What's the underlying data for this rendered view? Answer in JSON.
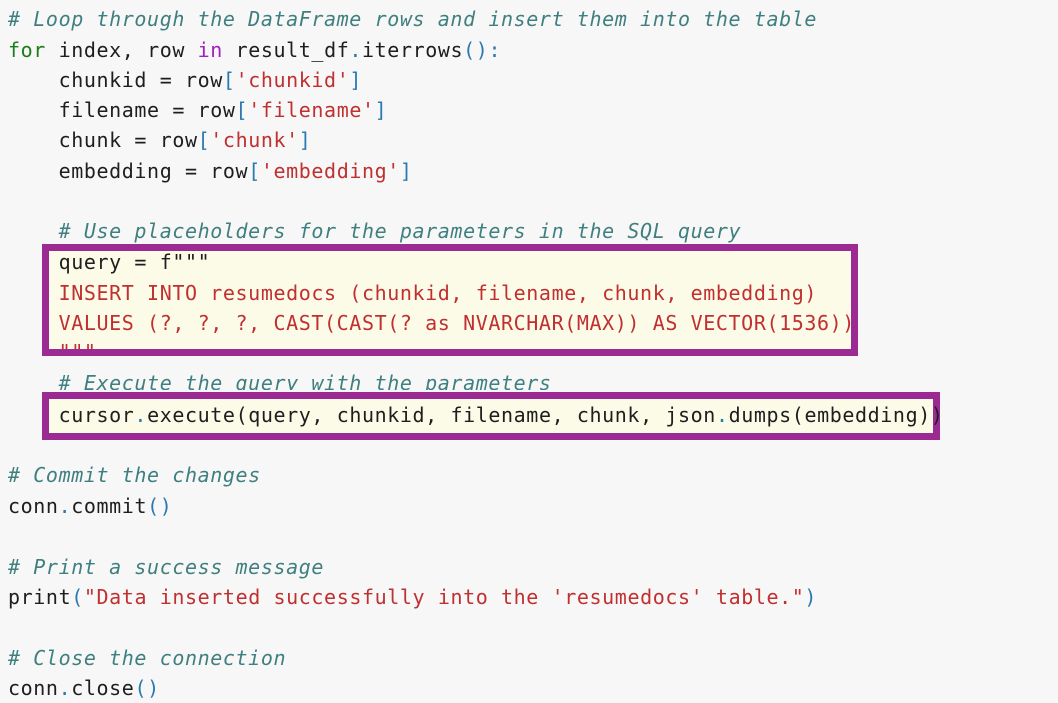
{
  "code": {
    "comment_loop": "# Loop through the DataFrame rows and insert them into the table",
    "for_kw": "for",
    "for_vars": " index, row ",
    "in_kw": "in",
    "for_iter": " result_df",
    "dot": ".",
    "iterrows": "iterrows",
    "parens_colon": "():",
    "chunkid_lhs": "    chunkid = row",
    "chunkid_str": "'chunkid'",
    "filename_lhs": "    filename = row",
    "filename_str": "'filename'",
    "chunk_lhs": "    chunk = row",
    "chunk_str": "'chunk'",
    "embedding_lhs": "    embedding = row",
    "embedding_str": "'embedding'",
    "lbr": "[",
    "rbr": "]",
    "comment_placeholders": "    # Use placeholders for the parameters in the SQL query",
    "query_line": "    query = f\"\"\"",
    "insert_line": "    INSERT INTO resumedocs (chunkid, filename, chunk, embedding)",
    "values_line": "    VALUES (?, ?, ?, CAST(CAST(? as NVARCHAR(MAX)) AS VECTOR(1536))",
    "close_quotes": "    \"\"\"",
    "comment_execute": "    # Execute the query with the parameters",
    "cursor": "    cursor",
    "execute_args": "execute(query, chunkid, filename, chunk, json",
    "dumps": "dumps(embedding))",
    "comment_commit": "# Commit the changes",
    "conn": "conn",
    "commit": "commit",
    "close": "close",
    "empty_parens": "()",
    "comment_print": "# Print a success message",
    "print_fn": "print",
    "print_str": "\"Data inserted successfully into the 'resumedocs' table.\"",
    "lparen": "(",
    "rparen": ")",
    "comment_close": "# Close the connection"
  },
  "colors": {
    "highlight_border": "#9b2a92",
    "comment": "#3f7f7f",
    "string": "#c03030",
    "keyword_for": "#1a7f1a",
    "keyword_in": "#a020c0"
  }
}
